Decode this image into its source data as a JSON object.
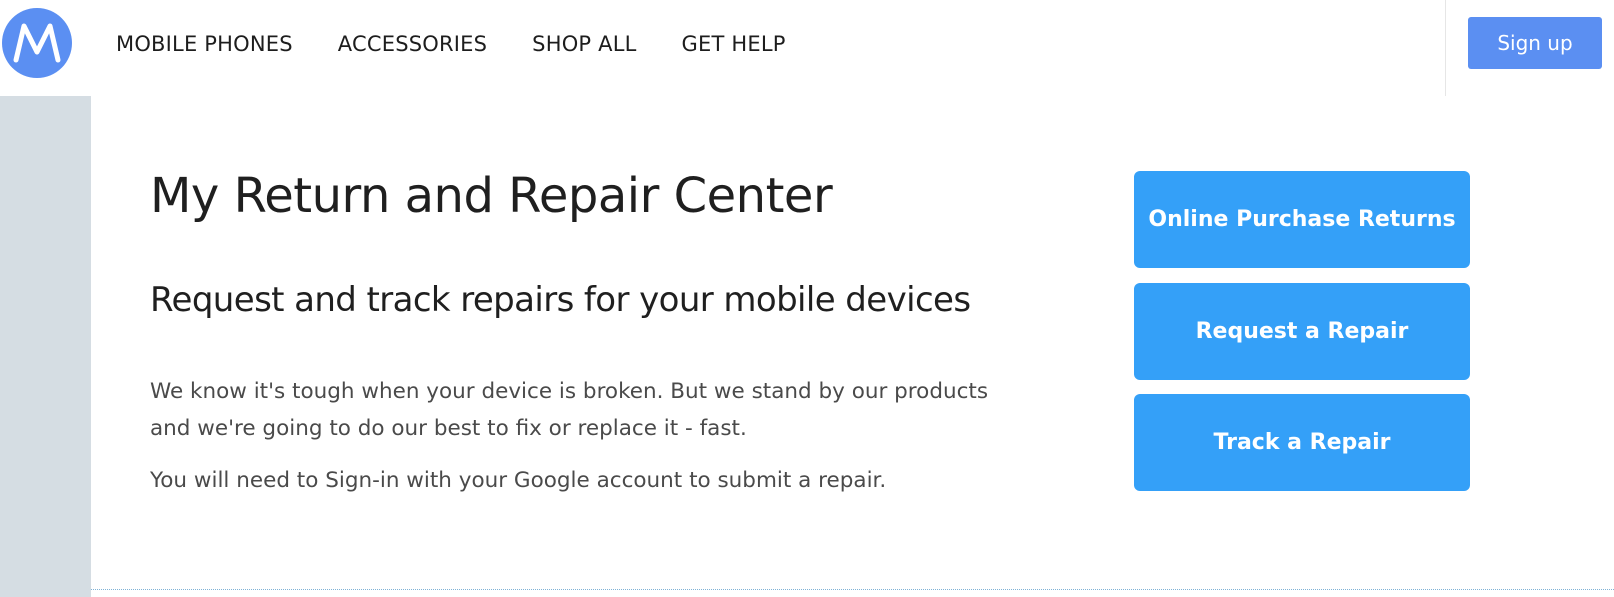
{
  "header": {
    "logo_icon": "motorola-batwing-icon",
    "nav": [
      {
        "label": "MOBILE PHONES"
      },
      {
        "label": "ACCESSORIES"
      },
      {
        "label": "SHOP ALL"
      },
      {
        "label": "GET HELP"
      }
    ],
    "signup_label": "Sign up"
  },
  "main": {
    "title": "My Return and Repair Center",
    "subtitle": "Request and track repairs for your mobile devices",
    "paragraph1": "We know it's tough when your device is broken. But we stand by our products and we're going to do our best to fix or replace it - fast.",
    "paragraph2": "You will need to Sign-in with your Google account to submit a repair."
  },
  "actions": {
    "online_purchase_returns": "Online Purchase Returns",
    "request_repair": "Request a Repair",
    "track_repair": "Track a Repair"
  },
  "colors": {
    "brand_blue": "#5b8ff2",
    "button_blue": "#34a0f8",
    "rail_gray": "#d5dde3"
  }
}
